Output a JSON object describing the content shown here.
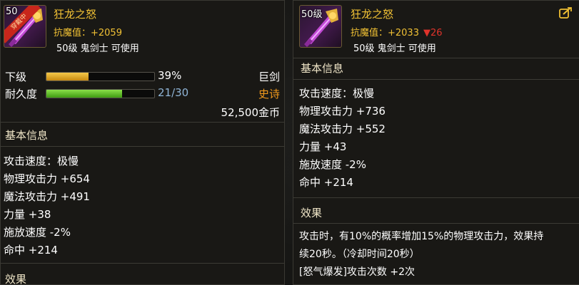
{
  "left": {
    "icon_level": "50",
    "icon_ribbon": "穿戴中",
    "name": "狂龙之怒",
    "resist": "抗魔值：+2059",
    "requirement": "50级 鬼剑士 可使用",
    "grade_label": "下级",
    "grade_pct": "39%",
    "grade_fraction": 0.39,
    "weapon_type": "巨剑",
    "durability_label": "耐久度",
    "durability": "21/30",
    "durability_fraction": 0.7,
    "rarity": "史诗",
    "price": "52,500金币",
    "basic_title": "基本信息",
    "stats": [
      "攻击速度：极慢",
      "物理攻击力 +654",
      "魔法攻击力 +491",
      "力量 +38",
      "施放速度 -2%",
      "命中 +214"
    ],
    "effect_title": "效果"
  },
  "right": {
    "icon_level": "50级",
    "name": "狂龙之怒",
    "resist": "抗魔值：+2033",
    "resist_change": "▼26",
    "requirement": "50级 鬼剑士 可使用",
    "basic_title": "基本信息",
    "stats": [
      "攻击速度：极慢",
      "物理攻击力 +736",
      "魔法攻击力 +552",
      "力量 +43",
      "施放速度 -2%",
      "命中 +214"
    ],
    "effect_title": "效果",
    "effect_line1": "攻击时，有10%的概率增加15%的物理攻击力，效果持",
    "effect_line2": "续20秒。（冷却时间20秒）",
    "effect_line3": "[怒气爆发]攻击次数 +2次"
  },
  "colors": {
    "name_gold": "#f0c034",
    "rarity_orange": "#f39a1c",
    "durability_blue": "#8fb4d6",
    "decrease_red": "#e0332b",
    "grade_bar": "#e0a820",
    "durability_bar": "#5fbf2a"
  },
  "icons": [
    "sword-item-icon",
    "edit-share-icon"
  ]
}
